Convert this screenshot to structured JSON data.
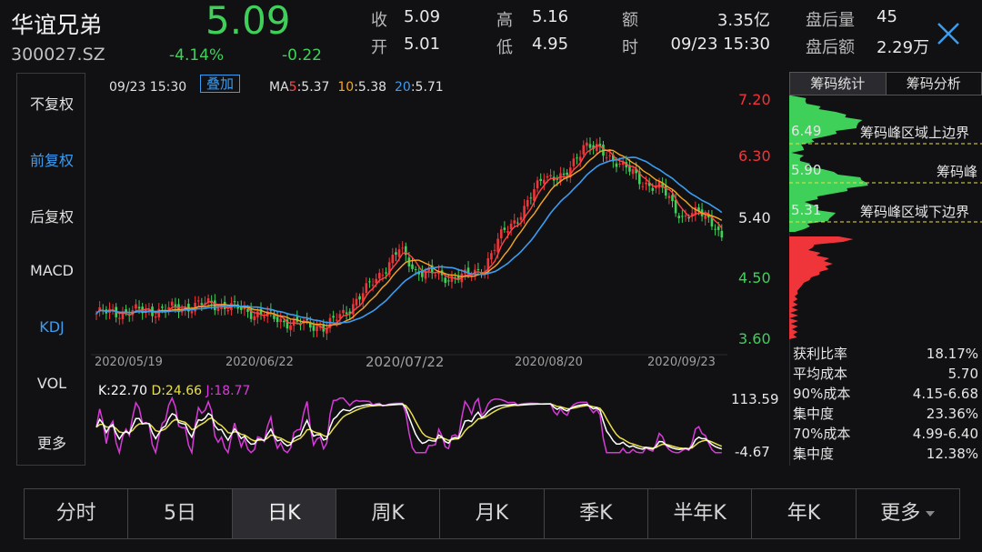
{
  "header": {
    "name": "华谊兄弟",
    "code": "300027.SZ",
    "price": "5.09",
    "pct_change": "-4.14%",
    "abs_change": "-0.22",
    "fields": [
      {
        "label": "收",
        "value": "5.09"
      },
      {
        "label": "开",
        "value": "5.01"
      },
      {
        "label": "高",
        "value": "5.16"
      },
      {
        "label": "低",
        "value": "4.95"
      },
      {
        "label": "额",
        "value": "3.35亿"
      },
      {
        "label": "时",
        "value": "09/23 15:30"
      },
      {
        "label": "盘后量",
        "value": "45"
      },
      {
        "label": "盘后额",
        "value": "2.29万"
      }
    ]
  },
  "left_menu": [
    {
      "label": "不复权",
      "active": false
    },
    {
      "label": "前复权",
      "active": true
    },
    {
      "label": "后复权",
      "active": false
    },
    {
      "label": "MACD",
      "active": false
    },
    {
      "label": "KDJ",
      "active": true
    },
    {
      "label": "VOL",
      "active": false
    },
    {
      "label": "更多",
      "active": false
    }
  ],
  "chart_info": {
    "time": "09/23 15:30",
    "overlay_button": "叠加",
    "ma_prefix": "MA",
    "ma": [
      {
        "period": "5",
        "value": "5.37",
        "color": "#ff4444"
      },
      {
        "period": "10",
        "value": "5.38",
        "color": "#f5a623"
      },
      {
        "period": "20",
        "value": "5.71",
        "color": "#3b9cf0"
      }
    ],
    "price_axis": [
      "7.20",
      "6.30",
      "5.40",
      "4.50",
      "3.60"
    ],
    "dates": [
      "2020/05/19",
      "2020/06/22",
      "2020/07/22",
      "2020/08/20",
      "2020/09/23"
    ],
    "kdj": {
      "k": "K:22.70",
      "d": "D:24.66",
      "j": "J:18.77",
      "axis_top": "113.59",
      "axis_bottom": "-4.67"
    }
  },
  "colors": {
    "up": "#f0353a",
    "down": "#3fd05a",
    "ma5": "#ff4444",
    "ma10": "#f5a623",
    "ma20": "#3b9cf0",
    "k": "#ffffff",
    "d": "#e8e04a",
    "j": "#d83ad8"
  },
  "chip_panel": {
    "tabs": [
      {
        "label": "筹码统计",
        "active": true
      },
      {
        "label": "筹码分析",
        "active": false
      }
    ],
    "upper_price": "6.49",
    "upper_label": "筹码峰区域上边界",
    "peak_price": "5.90",
    "peak_label": "筹码峰",
    "lower_price": "5.31",
    "lower_label": "筹码峰区域下边界",
    "stats": [
      {
        "label": "获利比率",
        "value": "18.17%"
      },
      {
        "label": "平均成本",
        "value": "5.70"
      },
      {
        "label": "90%成本",
        "value": "4.15-6.68"
      },
      {
        "label": "集中度",
        "value": "23.36%"
      },
      {
        "label": "70%成本",
        "value": "4.99-6.40"
      },
      {
        "label": "集中度",
        "value": "12.38%"
      }
    ]
  },
  "bottom_tabs": [
    {
      "label": "分时",
      "active": false
    },
    {
      "label": "5日",
      "active": false
    },
    {
      "label": "日K",
      "active": true
    },
    {
      "label": "周K",
      "active": false
    },
    {
      "label": "月K",
      "active": false
    },
    {
      "label": "季K",
      "active": false
    },
    {
      "label": "半年K",
      "active": false
    },
    {
      "label": "年K",
      "active": false
    },
    {
      "label": "更多",
      "active": false,
      "dropdown": true
    }
  ]
}
